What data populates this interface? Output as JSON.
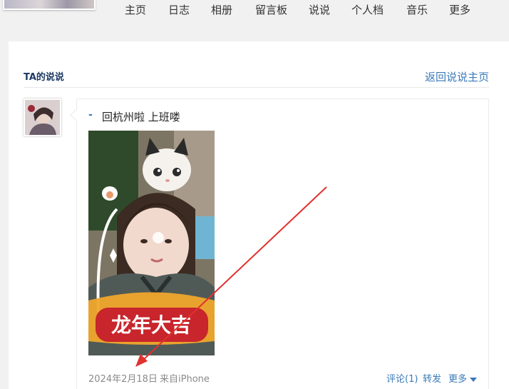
{
  "nav": {
    "items": [
      "主页",
      "日志",
      "相册",
      "留言板",
      "说说",
      "个人档",
      "音乐",
      "更多"
    ]
  },
  "section": {
    "title": "TA的说说",
    "back_link": "返回说说主页"
  },
  "post": {
    "dash": "-",
    "text": "回杭州啦 上班喽",
    "sticker_text": "龙年大吉",
    "date": "2024年2月18日",
    "source": "来自iPhone",
    "actions": {
      "comment": "评论(1)",
      "forward": "转发",
      "more": "更多"
    }
  },
  "colors": {
    "link": "#3a79b8",
    "title": "#1d3a63",
    "annotation_arrow": "#e0312e",
    "sticker_red": "#c8252c"
  },
  "icons": {
    "more_caret": "caret-down-icon",
    "annotation": "red-arrow"
  }
}
